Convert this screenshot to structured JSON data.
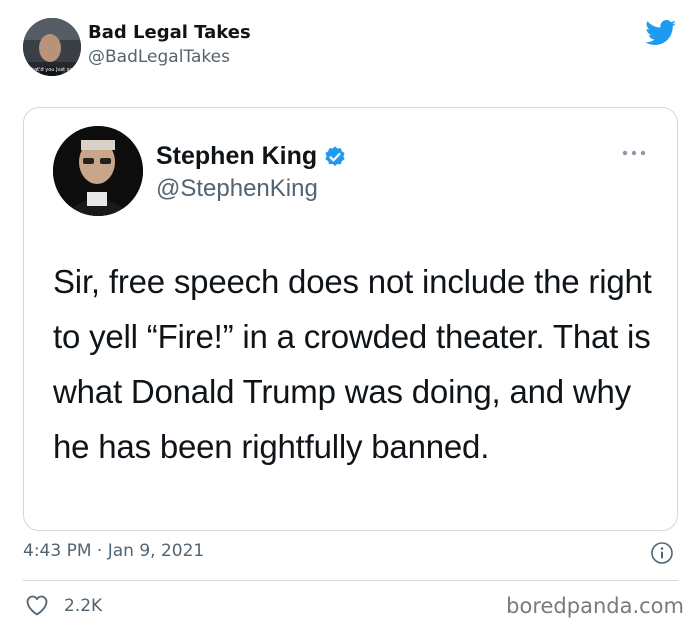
{
  "outer_tweet": {
    "display_name": "Bad Legal Takes",
    "handle": "@BadLegalTakes",
    "avatar_caption": "What'd you just say?",
    "avatar": "profile-photo"
  },
  "quoted_tweet": {
    "display_name": "Stephen King",
    "handle": "@StephenKing",
    "verified": true,
    "more_icon": "ellipsis-icon",
    "text": "Sir, free speech does not include the right to yell “Fire!” in a crowded theater. That is what Donald Trump was doing, and why he has been rightfully banned."
  },
  "footer": {
    "timestamp": "4:43 PM · Jan 9, 2021",
    "likes": "2.2K",
    "like_icon": "heart-icon",
    "info_icon": "info-icon"
  },
  "watermark": "boredpanda.com",
  "colors": {
    "twitter_blue": "#1d9bf0",
    "text_primary": "#0f1419",
    "text_secondary": "#536471",
    "border": "#cfd9de"
  }
}
